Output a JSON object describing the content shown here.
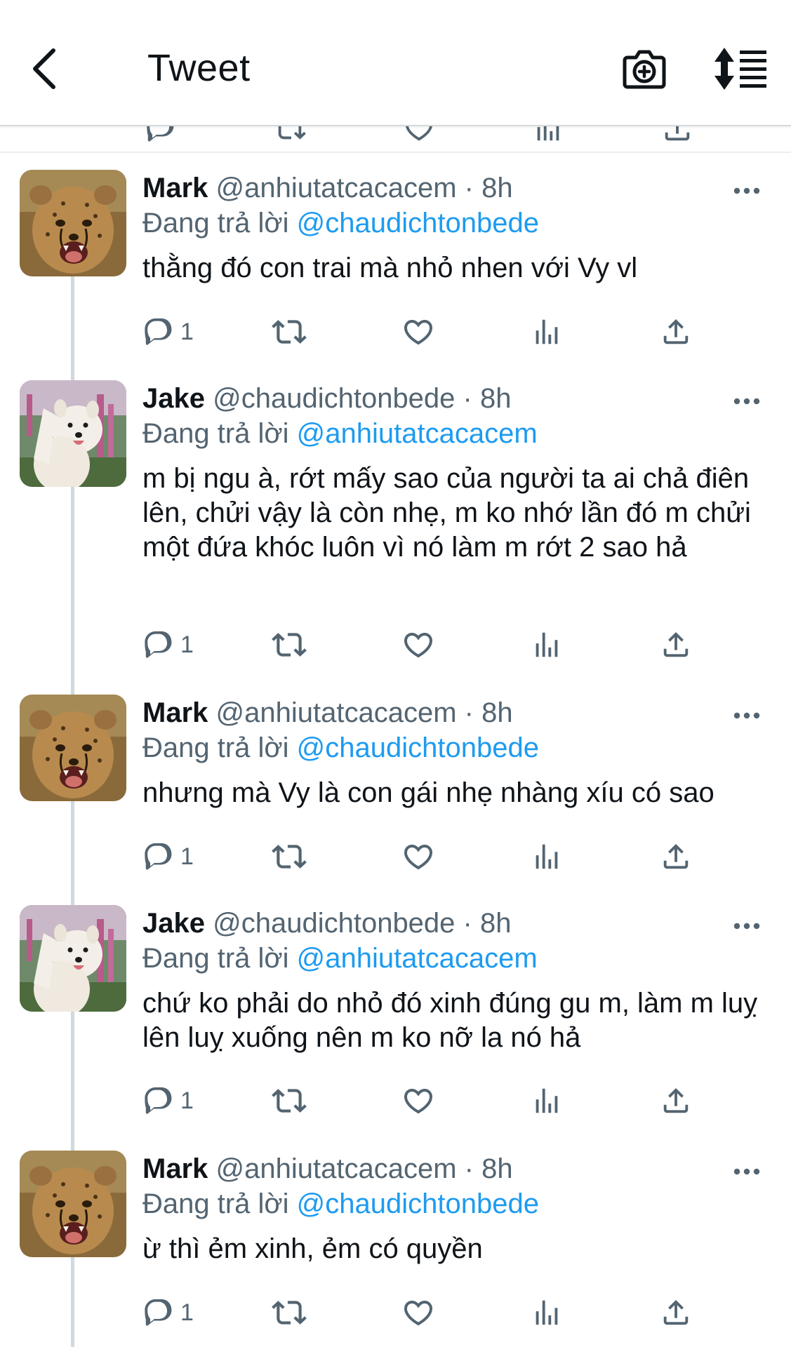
{
  "header": {
    "title": "Tweet",
    "back_icon": "chevron-left-icon",
    "camera_icon": "camera-plus-icon",
    "sort_icon": "sort-list-icon"
  },
  "colors": {
    "link": "#1d9bf0",
    "secondary_text": "#536471",
    "icon": "#536471",
    "thread_line": "#cfd9de"
  },
  "tweets": [
    {
      "name": "Mark",
      "handle": "@anhiutatcacacem",
      "dot": "·",
      "time": "8h",
      "reply_prefix": "Đang trả lời",
      "reply_to": "@chaudichtonbede",
      "text": "thằng đó con trai mà nhỏ nhen với Vy vl",
      "reply_count": "1",
      "avatar": "cheetah-avatar"
    },
    {
      "name": "Jake",
      "handle": "@chaudichtonbede",
      "dot": "·",
      "time": "8h",
      "reply_prefix": "Đang trả lời",
      "reply_to": "@anhiutatcacacem",
      "text": "m bị ngu à, rớt mấy sao của người ta ai chả điên lên, chửi vậy là còn nhẹ, m ko nhớ lần đó m chửi một đứa khóc luôn vì nó làm m rớt 2 sao hả",
      "reply_count": "1",
      "avatar": "samoyed-avatar"
    },
    {
      "name": "Mark",
      "handle": "@anhiutatcacacem",
      "dot": "·",
      "time": "8h",
      "reply_prefix": "Đang trả lời",
      "reply_to": "@chaudichtonbede",
      "text": "nhưng mà Vy là con gái nhẹ nhàng xíu có sao",
      "reply_count": "1",
      "avatar": "cheetah-avatar"
    },
    {
      "name": "Jake",
      "handle": "@chaudichtonbede",
      "dot": "·",
      "time": "8h",
      "reply_prefix": "Đang trả lời",
      "reply_to": "@anhiutatcacacem",
      "text": "chứ ko phải do nhỏ đó xinh đúng gu m, làm m luỵ lên luỵ xuống nên m ko nỡ la nó hả",
      "reply_count": "1",
      "avatar": "samoyed-avatar"
    },
    {
      "name": "Mark",
      "handle": "@anhiutatcacacem",
      "dot": "·",
      "time": "8h",
      "reply_prefix": "Đang trả lời",
      "reply_to": "@chaudichtonbede",
      "text": "ừ thì ẻm xinh, ẻm có quyền",
      "reply_count": "1",
      "avatar": "cheetah-avatar"
    }
  ]
}
